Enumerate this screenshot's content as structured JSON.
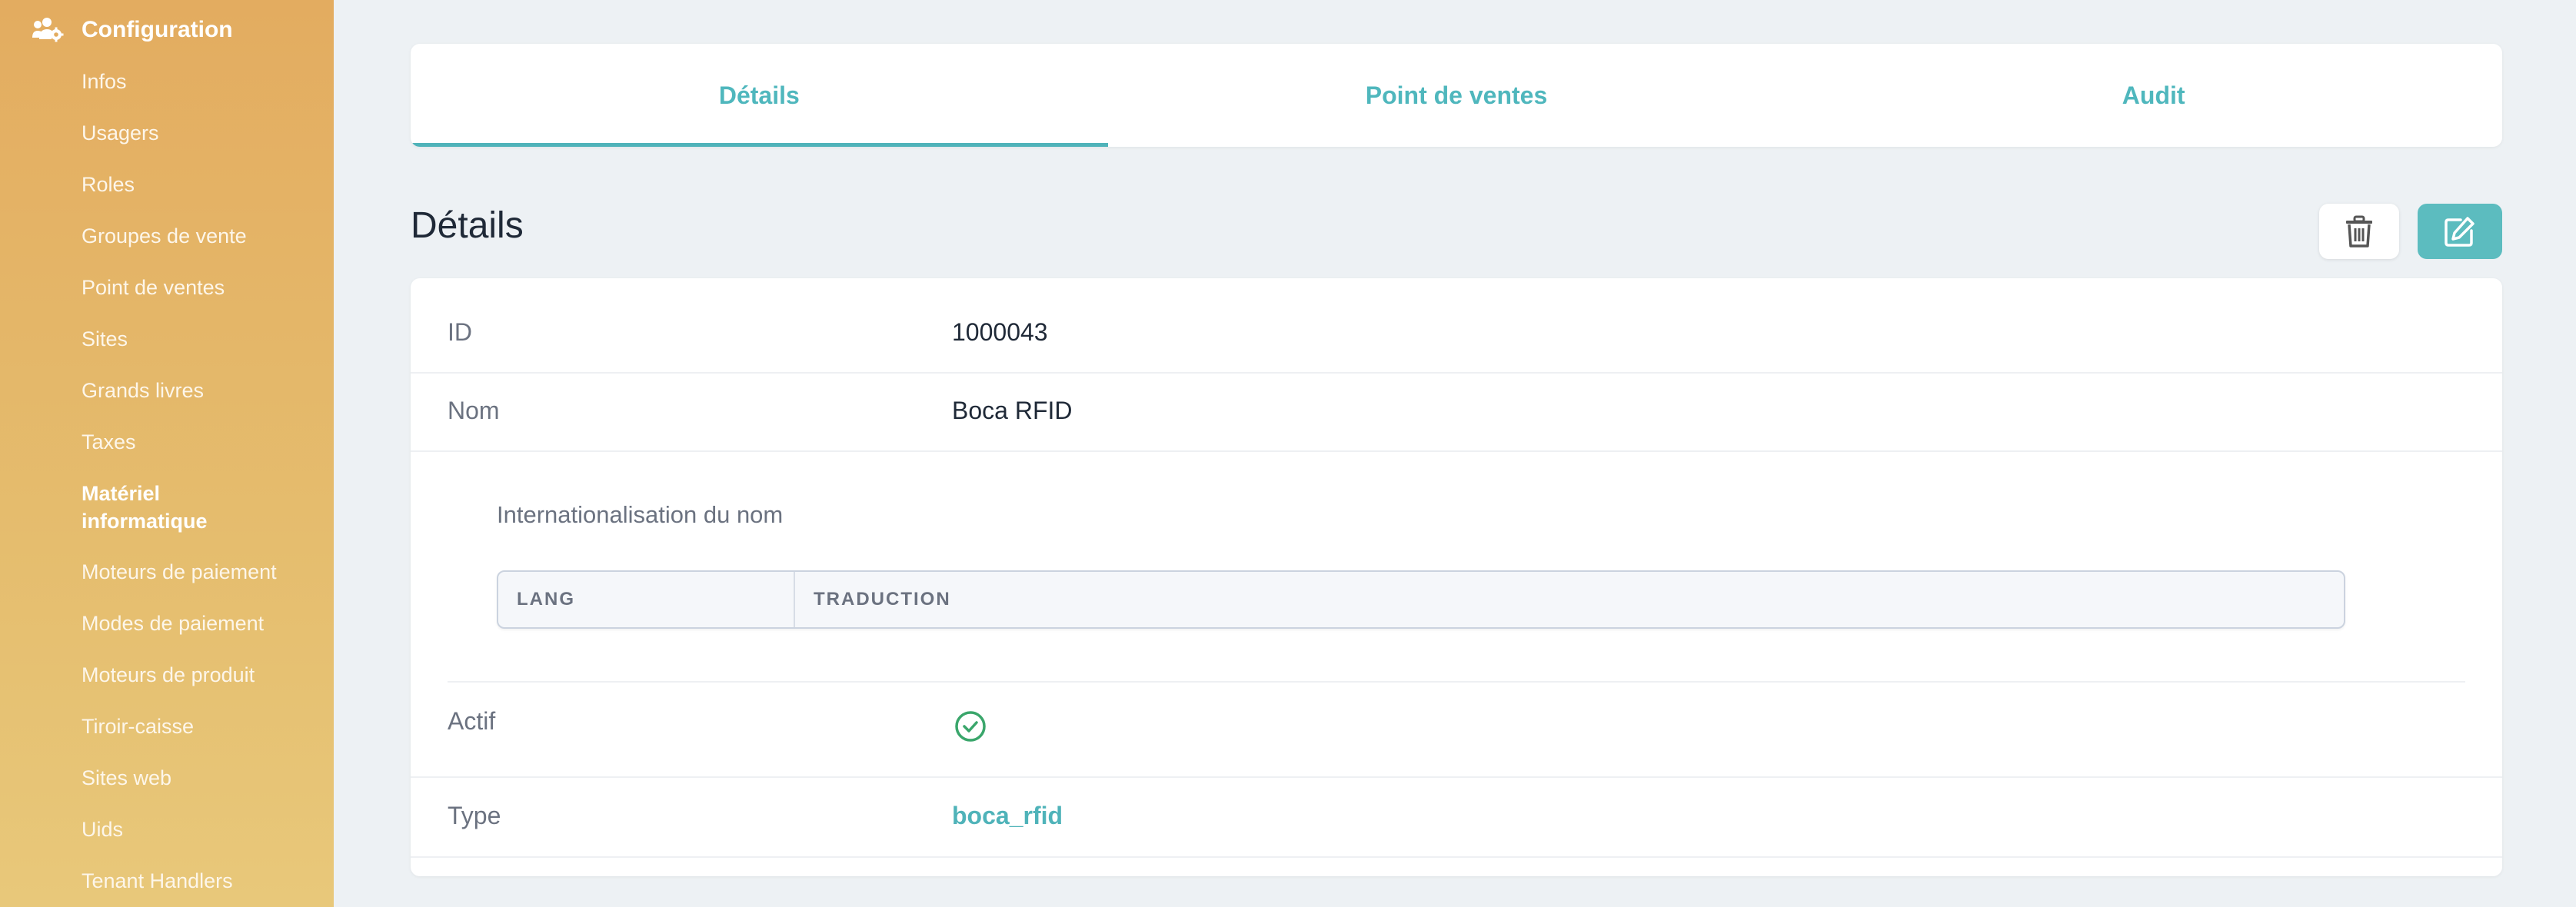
{
  "sidebar": {
    "title": "Configuration",
    "header_icon": "users-gear-icon",
    "items": [
      {
        "label": "Infos"
      },
      {
        "label": "Usagers"
      },
      {
        "label": "Roles"
      },
      {
        "label": "Groupes de vente"
      },
      {
        "label": "Point de ventes"
      },
      {
        "label": "Sites"
      },
      {
        "label": "Grands livres"
      },
      {
        "label": "Taxes"
      },
      {
        "label": "Matériel informatique",
        "active": true
      },
      {
        "label": "Moteurs de paiement"
      },
      {
        "label": "Modes de paiement"
      },
      {
        "label": "Moteurs de produit"
      },
      {
        "label": "Tiroir-caisse"
      },
      {
        "label": "Sites web"
      },
      {
        "label": "Uids"
      },
      {
        "label": "Tenant Handlers"
      }
    ]
  },
  "tabs": [
    {
      "label": "Détails",
      "active": true
    },
    {
      "label": "Point de ventes"
    },
    {
      "label": "Audit"
    }
  ],
  "section": {
    "title": "Détails",
    "delete_icon": "trash-icon",
    "edit_icon": "edit-icon"
  },
  "details": {
    "id": {
      "label": "ID",
      "value": "1000043"
    },
    "name": {
      "label": "Nom",
      "value": "Boca RFID"
    },
    "i18n": {
      "label": "Internationalisation du nom",
      "columns": [
        "LANG",
        "TRADUCTION"
      ]
    },
    "active": {
      "label": "Actif",
      "icon": "check-circle-icon"
    },
    "type": {
      "label": "Type",
      "value": "boca_rfid"
    }
  },
  "colors": {
    "accent": "#4fb3b9",
    "sidebar_top": "#e3ac60",
    "sidebar_bottom": "#e8c87a",
    "success": "#3aa66b"
  }
}
